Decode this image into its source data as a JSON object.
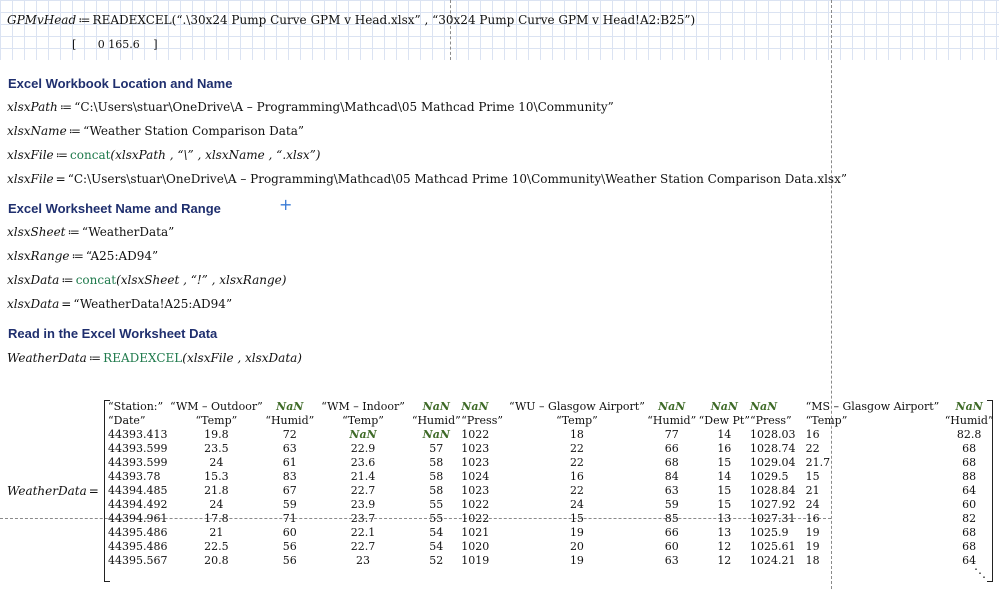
{
  "top": {
    "name": "GPMvHead",
    "assign": "≔",
    "fn": "READEXCEL",
    "args": "(“.\\30x24 Pump Curve GPM v Head.xlsx” , “30x24 Pump Curve GPM v Head!A2:B25”)",
    "vector_open": "[",
    "vector_values": "0    165.6",
    "vector_close": "]"
  },
  "sections": {
    "location": "Excel Workbook Location and Name",
    "worksheet": "Excel Worksheet Name and Range",
    "read": "Read in the Excel Worksheet Data"
  },
  "lines": {
    "xlsxPath": {
      "name": "xlsxPath",
      "op": "≔",
      "value": "“C:\\Users\\stuar\\OneDrive\\A – Programming\\Mathcad\\05 Mathcad Prime 10\\Community”"
    },
    "xlsxName": {
      "name": "xlsxName",
      "op": "≔",
      "value": "“Weather Station Comparison Data”"
    },
    "xlsxFileDef": {
      "name": "xlsxFile",
      "op": "≔",
      "fn": "concat",
      "args": "(xlsxPath , “\\” , xlsxName , “.xlsx”)"
    },
    "xlsxFileEval": {
      "name": "xlsxFile",
      "op": "=",
      "value": "“C:\\Users\\stuar\\OneDrive\\A – Programming\\Mathcad\\05 Mathcad Prime 10\\Community\\Weather Station Comparison Data.xlsx”"
    },
    "xlsxSheet": {
      "name": "xlsxSheet",
      "op": "≔",
      "value": "“WeatherData”"
    },
    "xlsxRange": {
      "name": "xlsxRange",
      "op": "≔",
      "value": "“A25:AD94”"
    },
    "xlsxDataDef": {
      "name": "xlsxData",
      "op": "≔",
      "fn": "concat",
      "args": "(xlsxSheet , “!” , xlsxRange)"
    },
    "xlsxDataEval": {
      "name": "xlsxData",
      "op": "=",
      "value": "“WeatherData!A25:AD94”"
    },
    "weatherDef": {
      "name": "WeatherData",
      "op": "≔",
      "fn": "READEXCEL",
      "args": "(xlsxFile , xlsxData)"
    }
  },
  "matrix": {
    "label": "WeatherData",
    "op": "=",
    "rows": [
      [
        "“Station:”",
        "“WM – Outdoor”",
        "NaN",
        "“WM – Indoor”",
        "NaN",
        "NaN",
        "“WU – Glasgow Airport”",
        "NaN",
        "NaN",
        "NaN",
        "“MS – Glasgow Airport”",
        "NaN"
      ],
      [
        "“Date”",
        "“Temp”",
        "“Humid”",
        "“Temp”",
        "“Humid”",
        "“Press”",
        "“Temp”",
        "“Humid”",
        "“Dew Pt”",
        "“Press”",
        "“Temp”",
        "“Humid”"
      ],
      [
        "44393.413",
        "19.8",
        "72",
        "NaN",
        "NaN",
        "1022",
        "18",
        "77",
        "14",
        "1028.03",
        "16",
        "82.8"
      ],
      [
        "44393.599",
        "23.5",
        "63",
        "22.9",
        "57",
        "1023",
        "22",
        "66",
        "16",
        "1028.74",
        "22",
        "68"
      ],
      [
        "44393.599",
        "24",
        "61",
        "23.6",
        "58",
        "1023",
        "22",
        "68",
        "15",
        "1029.04",
        "21.7",
        "68"
      ],
      [
        "44393.78",
        "15.3",
        "83",
        "21.4",
        "58",
        "1024",
        "16",
        "84",
        "14",
        "1029.5",
        "15",
        "88"
      ],
      [
        "44394.485",
        "21.8",
        "67",
        "22.7",
        "58",
        "1023",
        "22",
        "63",
        "15",
        "1028.84",
        "21",
        "64"
      ],
      [
        "44394.492",
        "24",
        "59",
        "23.9",
        "55",
        "1022",
        "24",
        "59",
        "15",
        "1027.92",
        "24",
        "60"
      ],
      [
        "44394.961",
        "17.8",
        "71",
        "23.7",
        "55",
        "1022",
        "15",
        "85",
        "13",
        "1027.31",
        "16",
        "82"
      ],
      [
        "44395.486",
        "21",
        "60",
        "22.1",
        "54",
        "1021",
        "19",
        "66",
        "13",
        "1025.9",
        "19",
        "68"
      ],
      [
        "44395.486",
        "22.5",
        "56",
        "22.7",
        "54",
        "1020",
        "20",
        "60",
        "12",
        "1025.61",
        "19",
        "68"
      ],
      [
        "44395.567",
        "20.8",
        "56",
        "23",
        "52",
        "1019",
        "19",
        "63",
        "12",
        "1024.21",
        "18",
        "64"
      ]
    ],
    "ellipsis": "⋱"
  }
}
